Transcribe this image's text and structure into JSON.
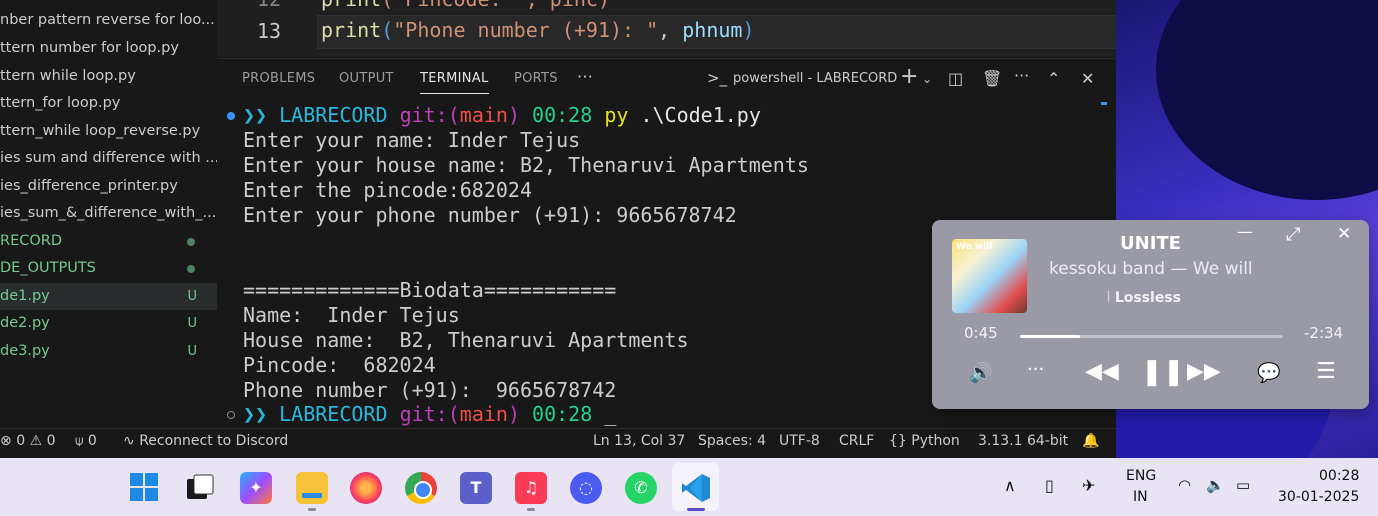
{
  "explorer": {
    "items": [
      {
        "label": "nber pattern reverse for loo..."
      },
      {
        "label": "ttern number for loop.py"
      },
      {
        "label": "ttern while loop.py"
      },
      {
        "label": "ttern_for loop.py"
      },
      {
        "label": "ttern_while loop_reverse.py"
      },
      {
        "label": "ies sum and difference with ..."
      },
      {
        "label": "ies_difference_printer.py"
      },
      {
        "label": "ies_sum_&_difference_with_..."
      },
      {
        "label": "RECORD"
      },
      {
        "label": "DE_OUTPUTS"
      },
      {
        "label": "de1.py",
        "status": "U"
      },
      {
        "label": "de2.py",
        "status": "U"
      },
      {
        "label": "de3.py",
        "status": "U"
      }
    ]
  },
  "editor": {
    "line_prev": "12",
    "line_number": "13",
    "code_prev_fn": "print",
    "code_prev_str": "(\"Pincode: \", pinc)",
    "code_fn": "print",
    "code_paren_open": "(",
    "code_str": "\"Phone number (+91): \"",
    "code_comma": ", ",
    "code_var": "phnum",
    "code_paren_close": ")"
  },
  "panel": {
    "tabs": [
      "PROBLEMS",
      "OUTPUT",
      "TERMINAL",
      "PORTS"
    ],
    "more": "···",
    "terminal_name": "powershell - LABRECORD"
  },
  "terminal": {
    "prompt_arrows": "❯❯",
    "prompt_dir": "LABRECORD",
    "prompt_git": "git:",
    "prompt_paren_open": "(",
    "prompt_branch": "main",
    "prompt_paren_close": ")",
    "prompt_time": "00:28",
    "cmd_py": "py",
    "cmd_arg": ".\\Code1.py",
    "lines": [
      "Enter your name: Inder Tejus",
      "Enter your house name: B2, Thenaruvi Apartments",
      "Enter the pincode:682024",
      "Enter your phone number (+91): 9665678742",
      "",
      "",
      "=============Biodata===========",
      "Name:  Inder Tejus",
      "House name:  B2, Thenaruvi Apartments",
      "Pincode:  682024",
      "Phone number (+91):  9665678742"
    ],
    "cursor": "_"
  },
  "statusbar": {
    "errors": "0",
    "warnings": "0",
    "ports": "0",
    "discord": "Reconnect to Discord",
    "position": "Ln 13, Col 37",
    "spaces": "Spaces: 4",
    "encoding": "UTF-8",
    "eol": "CRLF",
    "lang_icon": "{}",
    "language": "Python",
    "interpreter": "3.13.1 64-bit"
  },
  "player": {
    "title": "UNITE",
    "artist": "kessoku band — We will",
    "quality": "Lossless",
    "time_current": "0:45",
    "time_remaining": "-2:34",
    "progress": 0.23,
    "art_tag": "We will"
  },
  "taskbar": {
    "lang": "ENG",
    "region": "IN",
    "time": "00:28",
    "date": "30-01-2025"
  }
}
